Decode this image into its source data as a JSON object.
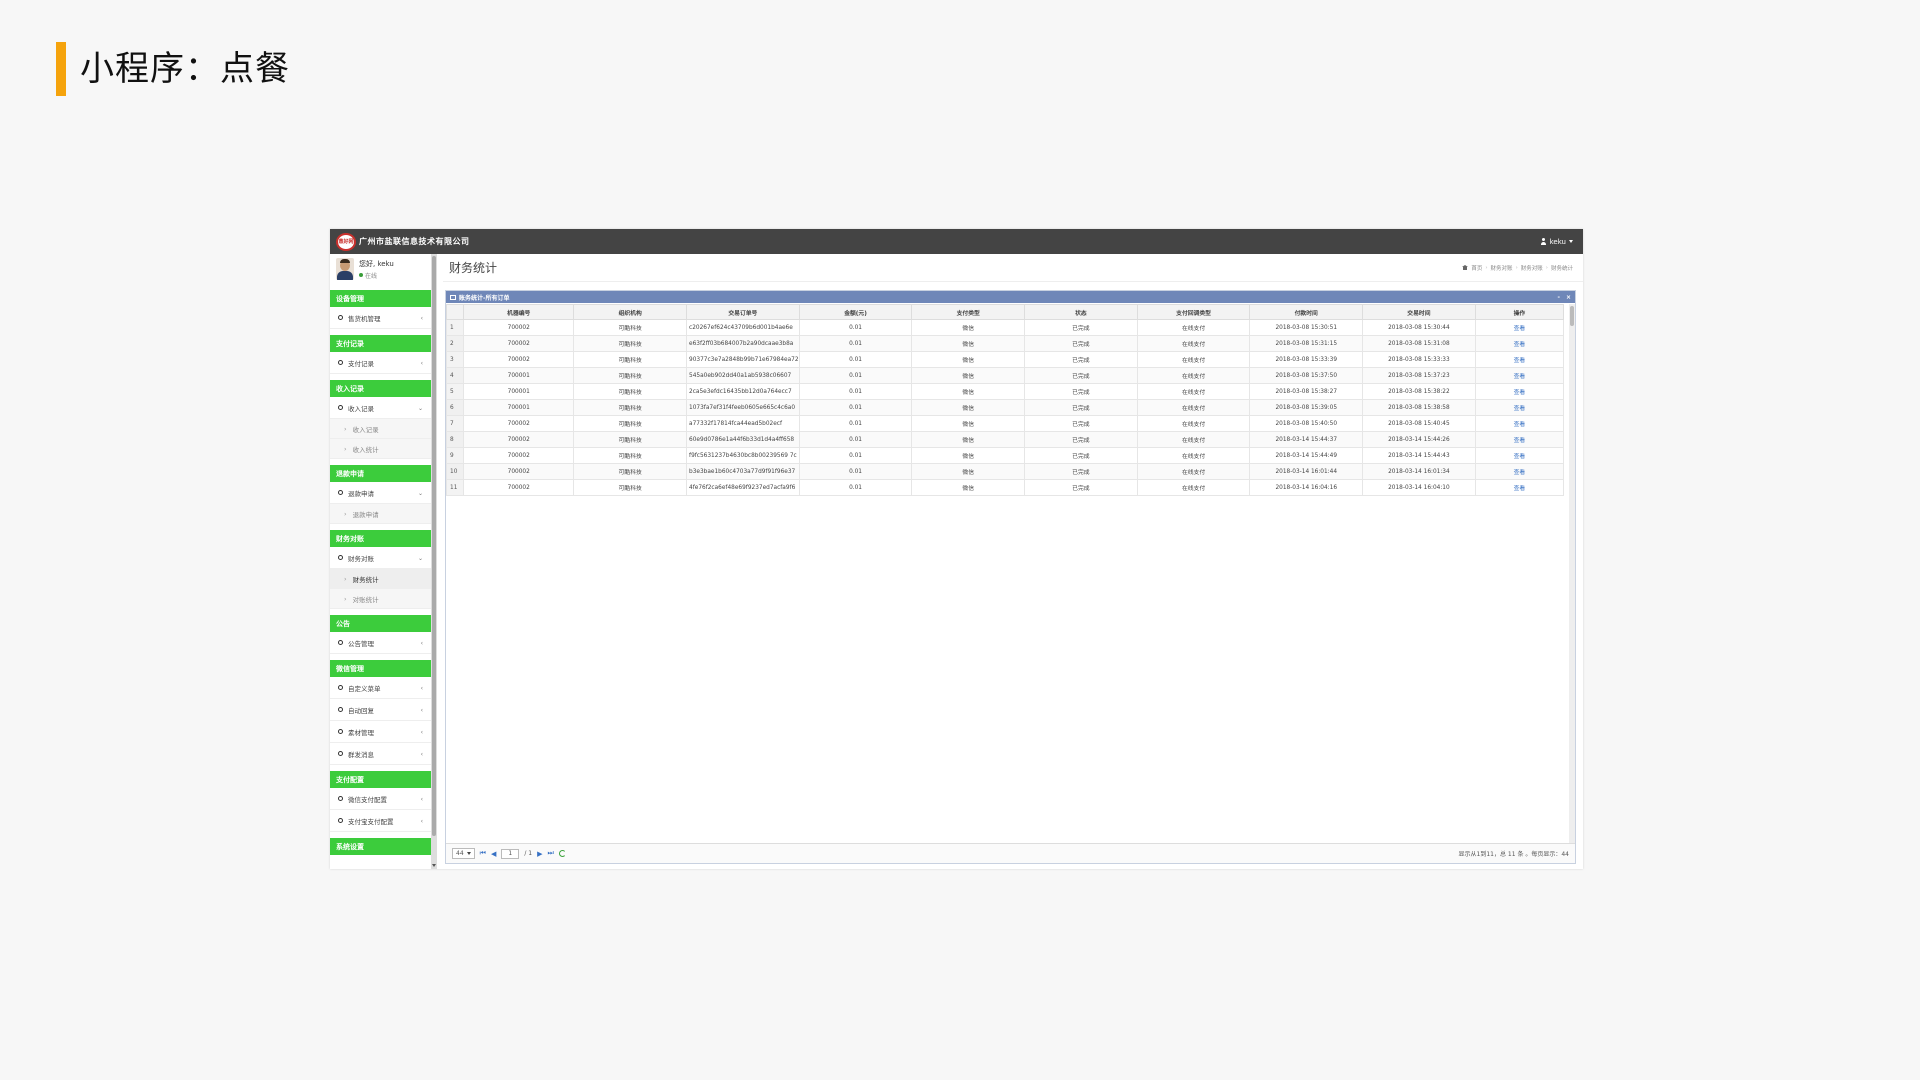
{
  "slide": {
    "title": "小程序：点餐",
    "accent_color": "#f5a30c"
  },
  "app": {
    "logo_text": "鼎好网",
    "brand": "广州市盐联信息技术有限公司",
    "user": "keku"
  },
  "profile": {
    "greeting": "您好, keku",
    "status": "在线"
  },
  "sidebar": {
    "sections": [
      {
        "title": "设备管理",
        "items": [
          {
            "label": "售货机管理",
            "chevron": "‹",
            "subs": []
          }
        ]
      },
      {
        "title": "支付记录",
        "items": [
          {
            "label": "支付记录",
            "chevron": "‹",
            "subs": []
          }
        ]
      },
      {
        "title": "收入记录",
        "items": [
          {
            "label": "收入记录",
            "chevron": "⌄",
            "subs": [
              "收入记录",
              "收入统计"
            ]
          }
        ]
      },
      {
        "title": "退款申请",
        "items": [
          {
            "label": "退款申请",
            "chevron": "⌄",
            "subs": [
              "退款申请"
            ]
          }
        ]
      },
      {
        "title": "财务对账",
        "items": [
          {
            "label": "财务对账",
            "chevron": "⌄",
            "subs": [
              "财务统计",
              "对账统计"
            ]
          }
        ]
      },
      {
        "title": "公告",
        "items": [
          {
            "label": "公告管理",
            "chevron": "‹",
            "subs": []
          }
        ]
      },
      {
        "title": "微信管理",
        "items": [
          {
            "label": "自定义菜单",
            "chevron": "‹",
            "subs": []
          },
          {
            "label": "自动回复",
            "chevron": "‹",
            "subs": []
          },
          {
            "label": "素材管理",
            "chevron": "‹",
            "subs": []
          },
          {
            "label": "群发消息",
            "chevron": "‹",
            "subs": []
          }
        ]
      },
      {
        "title": "支付配置",
        "items": [
          {
            "label": "微信支付配置",
            "chevron": "‹",
            "subs": []
          },
          {
            "label": "支付宝支付配置",
            "chevron": "‹",
            "subs": []
          }
        ]
      },
      {
        "title": "系统设置",
        "items": []
      }
    ],
    "active_sub": "财务统计"
  },
  "main": {
    "page_title": "财务统计",
    "breadcrumbs": [
      "首页",
      "财务对账",
      "财务对账",
      "财务统计"
    ]
  },
  "panel": {
    "title": "账务统计-所有订单",
    "tools": [
      "-",
      "×"
    ]
  },
  "table": {
    "columns": [
      "",
      "机器编号",
      "组织机构",
      "交易订单号",
      "金额(元)",
      "支付类型",
      "状态",
      "支付回调类型",
      "付款时间",
      "交易时间",
      "操作"
    ],
    "rows": [
      [
        "1",
        "700002",
        "可酷科技",
        "c20267ef624c43709b6d001b4ae6e",
        "0.01",
        "微信",
        "已完成",
        "在线支付",
        "2018-03-08 15:30:51",
        "2018-03-08 15:30:44",
        "查看"
      ],
      [
        "2",
        "700002",
        "可酷科技",
        "e63f2ff03b684007b2a90dcaae3b8a",
        "0.01",
        "微信",
        "已完成",
        "在线支付",
        "2018-03-08 15:31:15",
        "2018-03-08 15:31:08",
        "查看"
      ],
      [
        "3",
        "700002",
        "可酷科技",
        "90377c3e7a2848b99b71e67984ea72",
        "0.01",
        "微信",
        "已完成",
        "在线支付",
        "2018-03-08 15:33:39",
        "2018-03-08 15:33:33",
        "查看"
      ],
      [
        "4",
        "700001",
        "可酷科技",
        "545a0eb902dd40a1ab5938c06607",
        "0.01",
        "微信",
        "已完成",
        "在线支付",
        "2018-03-08 15:37:50",
        "2018-03-08 15:37:23",
        "查看"
      ],
      [
        "5",
        "700001",
        "可酷科技",
        "2ca5e3efdc16435bb12d0a764ecc7",
        "0.01",
        "微信",
        "已完成",
        "在线支付",
        "2018-03-08 15:38:27",
        "2018-03-08 15:38:22",
        "查看"
      ],
      [
        "6",
        "700001",
        "可酷科技",
        "1073fa7ef31f4feeb0605e665c4c6a0",
        "0.01",
        "微信",
        "已完成",
        "在线支付",
        "2018-03-08 15:39:05",
        "2018-03-08 15:38:58",
        "查看"
      ],
      [
        "7",
        "700002",
        "可酷科技",
        "a77332f17814fca44ead5b02ecf",
        "0.01",
        "微信",
        "已完成",
        "在线支付",
        "2018-03-08 15:40:50",
        "2018-03-08 15:40:45",
        "查看"
      ],
      [
        "8",
        "700002",
        "可酷科技",
        "60e9d0786e1a44f6b33d1d4a4ff658",
        "0.01",
        "微信",
        "已完成",
        "在线支付",
        "2018-03-14 15:44:37",
        "2018-03-14 15:44:26",
        "查看"
      ],
      [
        "9",
        "700002",
        "可酷科技",
        "f9fc5631237b4630bc8b00239569 7c",
        "0.01",
        "微信",
        "已完成",
        "在线支付",
        "2018-03-14 15:44:49",
        "2018-03-14 15:44:43",
        "查看"
      ],
      [
        "10",
        "700002",
        "可酷科技",
        "b3e3bae1b60c4703a77d9f91f96e37",
        "0.01",
        "微信",
        "已完成",
        "在线支付",
        "2018-03-14 16:01:44",
        "2018-03-14 16:01:34",
        "查看"
      ],
      [
        "11",
        "700002",
        "可酷科技",
        "4fe76f2ca6ef48e69f9237ed7acfa9f6",
        "0.01",
        "微信",
        "已完成",
        "在线支付",
        "2018-03-14 16:04:16",
        "2018-03-14 16:04:10",
        "查看"
      ]
    ]
  },
  "pager": {
    "page_size": "44",
    "current_page": "1",
    "total_pages": "/ 1",
    "summary": "显示从1到11，总 11 条 。每页显示：44"
  },
  "colors": {
    "topbar": "#444444",
    "section_head": "#3ccc3c",
    "panel_head": "#6f87b8",
    "link": "#3670c4"
  }
}
